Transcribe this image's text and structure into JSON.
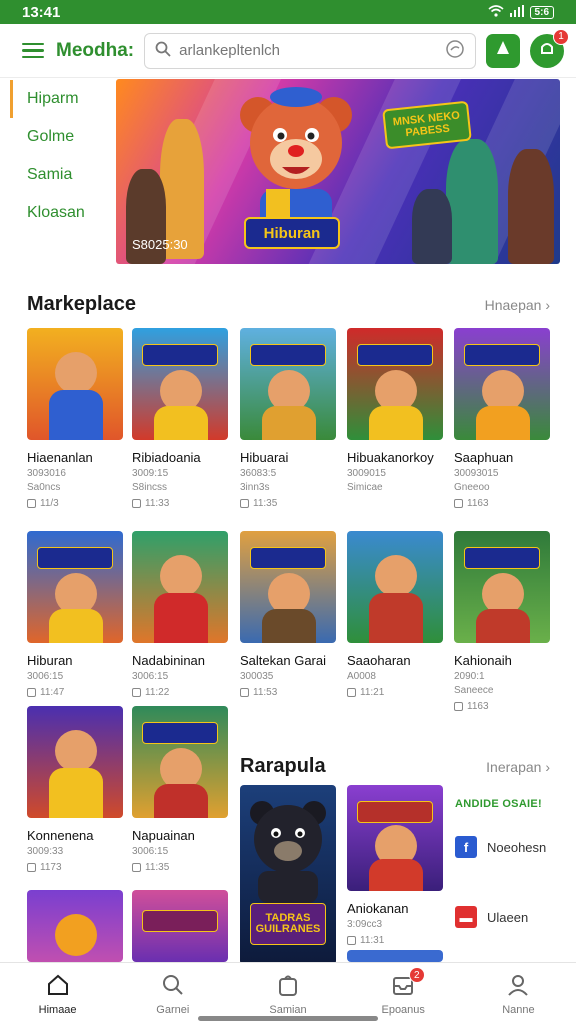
{
  "status": {
    "time": "13:41",
    "battery": "5:6"
  },
  "appbar": {
    "brand": "Meodha:",
    "search_placeholder": "arlankepltenlch",
    "notif_count": "1"
  },
  "sidenav": [
    "Hiparm",
    "Golme",
    "Samia",
    "Kloasan"
  ],
  "hero": {
    "caption": "S8025:30",
    "banner_text": "Hiburan",
    "tag_text": "MNSK NEKO PABESS"
  },
  "marketplace": {
    "title": "Markeplace",
    "more": "Hnaepan",
    "cards": [
      {
        "name": "Hiaenanlan",
        "sub1": "3093016",
        "sub2": "Sa0ncs",
        "stat": "11/3"
      },
      {
        "name": "Ribiadoania",
        "sub1": "3009:15",
        "sub2": "S8incss",
        "stat": "11:33"
      },
      {
        "name": "Hibuarai",
        "sub1": "36083:5",
        "sub2": "3inn3s",
        "stat": "11:35"
      },
      {
        "name": "Hibuakanorkoy",
        "sub1": "3009015",
        "sub2": "Simicae",
        "stat": ""
      },
      {
        "name": "Saaphuan",
        "sub1": "30093015",
        "sub2": "Gneeoo",
        "stat": "1163"
      },
      {
        "name": "Hiburan",
        "sub1": "3006:15",
        "sub2": "",
        "stat": "11:47"
      },
      {
        "name": "Nadabininan",
        "sub1": "3006:15",
        "sub2": "",
        "stat": "11:22"
      },
      {
        "name": "Saltekan Garai",
        "sub1": "300035",
        "sub2": "",
        "stat": "11:53"
      },
      {
        "name": "Saaoharan",
        "sub1": "A0008",
        "sub2": "",
        "stat": "11:21"
      },
      {
        "name": "Kahionaih",
        "sub1": "2090:1",
        "sub2": "Saneece",
        "stat": "1163"
      },
      {
        "name": "Konnenena",
        "sub1": "3009:33",
        "sub2": "",
        "stat": "1173"
      },
      {
        "name": "Napuainan",
        "sub1": "3006:15",
        "sub2": "",
        "stat": "11:35"
      }
    ]
  },
  "rarapula": {
    "title": "Rarapula",
    "more": "Inerapan",
    "big_logo": "TADRAS GUILRANES",
    "card": {
      "name": "Aniokanan",
      "sub1": "3:09cc3",
      "stat": "11:31"
    },
    "side_heading": "ANDIDE OSAIE!",
    "side_items": [
      "Noeohesn",
      "Ulaeen"
    ]
  },
  "tabs": [
    {
      "label": "Himaae",
      "icon": "home-icon"
    },
    {
      "label": "Garnei",
      "icon": "search-icon"
    },
    {
      "label": "Samian",
      "icon": "bag-icon"
    },
    {
      "label": "Epoanus",
      "icon": "inbox-icon",
      "badge": "2"
    },
    {
      "label": "Nanne",
      "icon": "person-icon"
    }
  ]
}
